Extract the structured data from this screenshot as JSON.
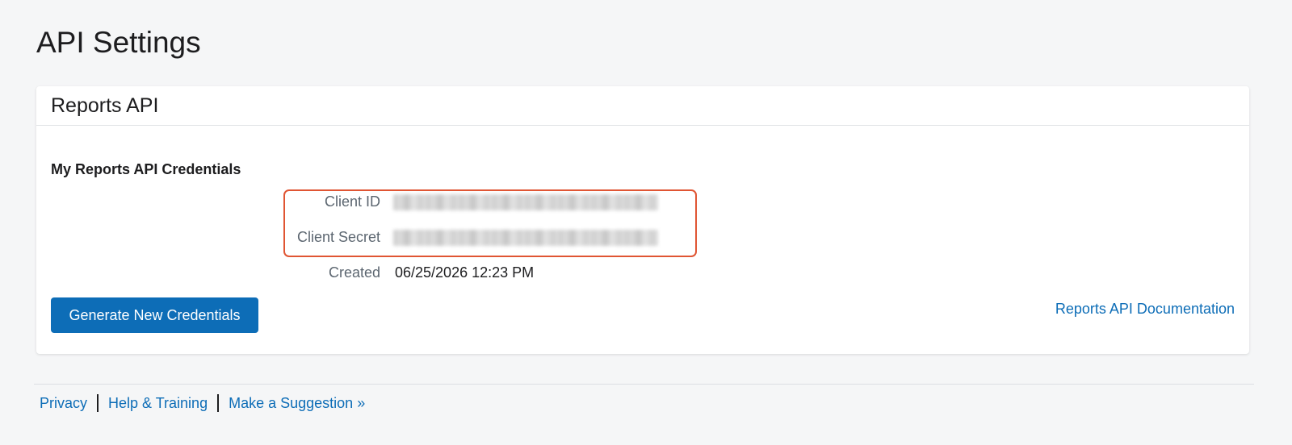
{
  "page": {
    "title": "API Settings"
  },
  "card": {
    "title": "Reports API",
    "section_title": "My Reports API Credentials",
    "fields": {
      "client_id_label": "Client ID",
      "client_secret_label": "Client Secret",
      "created_label": "Created",
      "created_value": "06/25/2026 12:23 PM"
    },
    "generate_button_label": "Generate New Credentials",
    "documentation_link": "Reports API Documentation"
  },
  "footer": {
    "links": [
      "Privacy",
      "Help & Training",
      "Make a Suggestion »"
    ]
  },
  "colors": {
    "accent": "#0d6db7",
    "highlight_border": "#e05533",
    "background": "#f5f6f7"
  }
}
